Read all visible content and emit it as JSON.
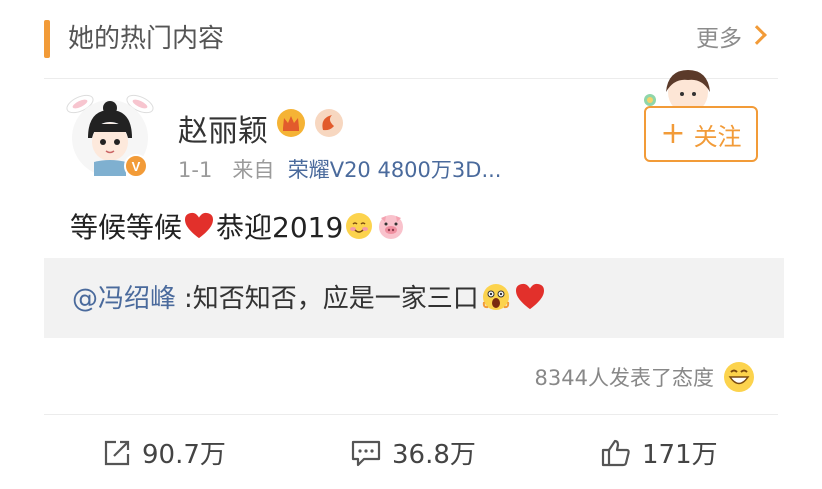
{
  "header": {
    "title": "她的热门内容",
    "more_label": "更多"
  },
  "post": {
    "author": "赵丽颖",
    "time": "1-1",
    "source_prefix": "来自",
    "source": "荣耀V20 4800万3D...",
    "follow_label": "关注",
    "text_main": "等候等候",
    "text_tail": "恭迎2019"
  },
  "quote": {
    "mention": "@冯绍峰",
    "text": ":知否知否，应是一家三口"
  },
  "attitudes": {
    "label": "8344人发表了态度"
  },
  "actions": {
    "repost": "90.7万",
    "comment": "36.8万",
    "like": "171万"
  },
  "colors": {
    "accent": "#f29b38",
    "link": "#4a6a9c",
    "heart": "#e2302b"
  }
}
